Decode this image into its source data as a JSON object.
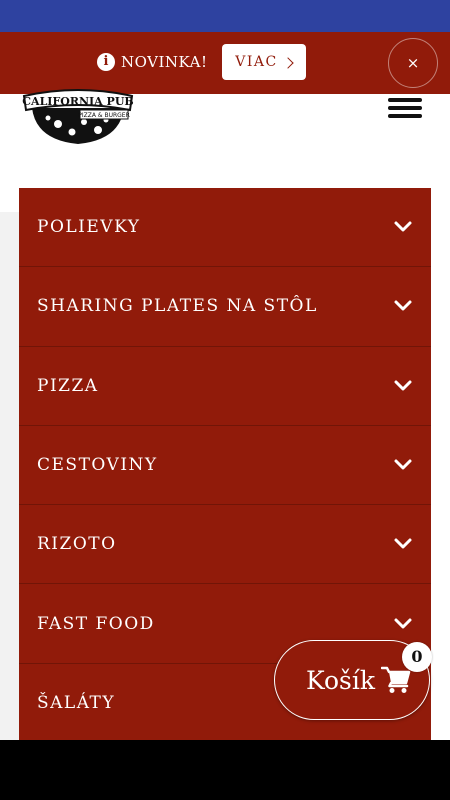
{
  "promo": {
    "icon": "info-icon",
    "label": "NOVINKA!",
    "more_label": "VIAC",
    "close_label": "×"
  },
  "header": {
    "logo_text": "CALIFORNIA PUB",
    "logo_subtext": "PIZZA & BURGER"
  },
  "menu": {
    "items": [
      {
        "label": "POLIEVKY"
      },
      {
        "label": "SHARING PLATES NA STÔL"
      },
      {
        "label": "PIZZA"
      },
      {
        "label": "CESTOVINY"
      },
      {
        "label": "RIZOTO"
      },
      {
        "label": "FAST FOOD"
      },
      {
        "label": "ŠALÁTY"
      }
    ]
  },
  "cart": {
    "label": "Košík",
    "count": "0",
    "icon": "cart-icon"
  },
  "colors": {
    "brand_red": "#911b0a",
    "status_blue": "#2e42a0"
  }
}
